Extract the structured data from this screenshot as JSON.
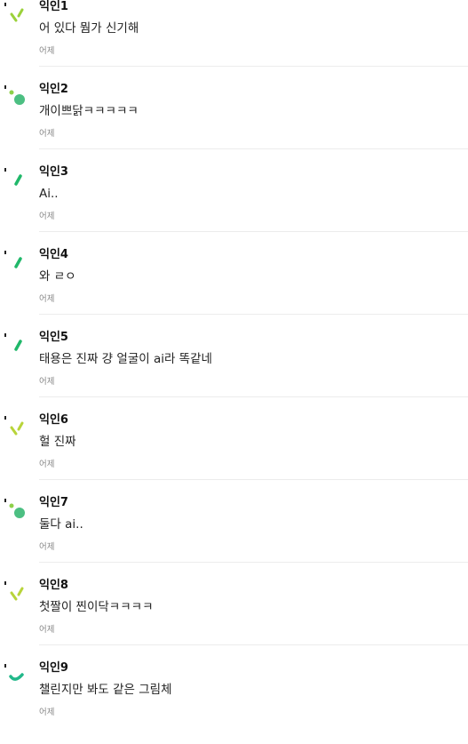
{
  "comments": [
    {
      "author": "익인1",
      "text": "어 있다 뭠가 신기해",
      "time": "어제",
      "avatar_icon": "slash-pair-icon",
      "avatar_color": "#9bd13a"
    },
    {
      "author": "익인2",
      "text": "개이쁘닭ㅋㅋㅋㅋㅋ",
      "time": "어제",
      "avatar_icon": "dot-circle-icon",
      "avatar_color": "#4cbf82"
    },
    {
      "author": "익인3",
      "text": "Ai..",
      "time": "어제",
      "avatar_icon": "single-slash-icon",
      "avatar_color": "#20b86a"
    },
    {
      "author": "익인4",
      "text": "와 ㄹㅇ",
      "time": "어제",
      "avatar_icon": "single-slash-icon",
      "avatar_color": "#20b86a"
    },
    {
      "author": "익인5",
      "text": "태용은 진짜 걍 얼굴이 ai라 똑같네",
      "time": "어제",
      "avatar_icon": "single-slash-icon",
      "avatar_color": "#20b86a"
    },
    {
      "author": "익인6",
      "text": "헐 진짜",
      "time": "어제",
      "avatar_icon": "slash-pair-icon",
      "avatar_color": "#b8d43a"
    },
    {
      "author": "익인7",
      "text": "둘다 ai..",
      "time": "어제",
      "avatar_icon": "dot-circle-icon",
      "avatar_color": "#4cbf82"
    },
    {
      "author": "익인8",
      "text": "첫짤이 찐이닥ㅋㅋㅋㅋ",
      "time": "어제",
      "avatar_icon": "slash-pair-icon",
      "avatar_color": "#b8d43a"
    },
    {
      "author": "익인9",
      "text": "챌린지만 봐도 같은 그림체",
      "time": "어제",
      "avatar_icon": "arc-icon",
      "avatar_color": "#22b88a"
    }
  ]
}
